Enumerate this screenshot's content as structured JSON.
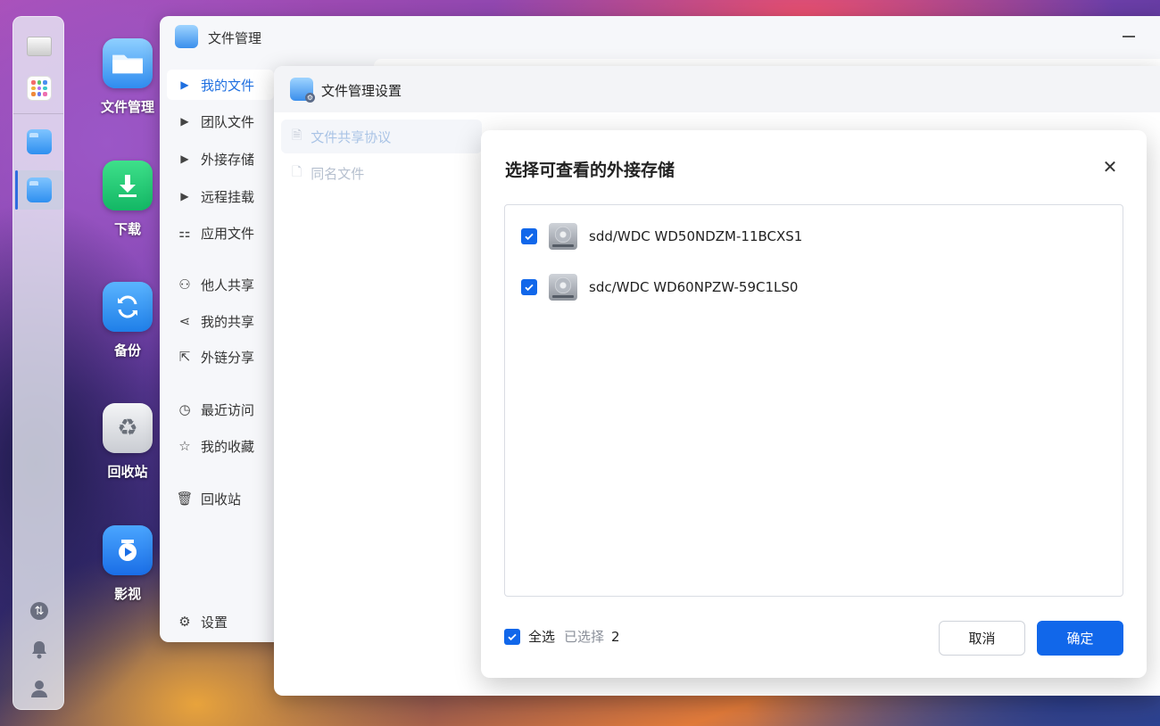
{
  "desktop": {
    "icons": [
      {
        "label": "文件管理"
      },
      {
        "label": "下载"
      },
      {
        "label": "备份"
      },
      {
        "label": "回收站"
      },
      {
        "label": "影视"
      }
    ]
  },
  "file_manager": {
    "title": "文件管理",
    "nav": [
      {
        "label": "我的文件",
        "icon": "caret-right-icon"
      },
      {
        "label": "团队文件",
        "icon": "caret-right-icon"
      },
      {
        "label": "外接存储",
        "icon": "caret-right-icon"
      },
      {
        "label": "远程挂载",
        "icon": "caret-right-icon"
      },
      {
        "label": "应用文件",
        "icon": "grid-icon"
      },
      {
        "label": "他人共享",
        "icon": "user-icon"
      },
      {
        "label": "我的共享",
        "icon": "share-icon"
      },
      {
        "label": "外链分享",
        "icon": "external-share-icon"
      },
      {
        "label": "最近访问",
        "icon": "clock-icon"
      },
      {
        "label": "我的收藏",
        "icon": "star-icon"
      },
      {
        "label": "回收站",
        "icon": "trash-icon"
      },
      {
        "label": "设置",
        "icon": "gear-icon"
      }
    ]
  },
  "settings_window": {
    "title": "文件管理设置",
    "sidebar": [
      {
        "label": "文件共享协议"
      },
      {
        "label": "同名文件"
      }
    ]
  },
  "modal": {
    "title": "选择可查看的外接存储",
    "items": [
      {
        "name": "sdd/WDC WD50NDZM-11BCXS1",
        "checked": true
      },
      {
        "name": "sdc/WDC WD60NPZW-59C1LS0",
        "checked": true
      }
    ],
    "select_all_label": "全选",
    "selected_label": "已选择",
    "selected_count": "2",
    "cancel_label": "取消",
    "ok_label": "确定"
  },
  "colors": {
    "accent": "#1167ea",
    "nav_active": "#1e6fe0"
  }
}
